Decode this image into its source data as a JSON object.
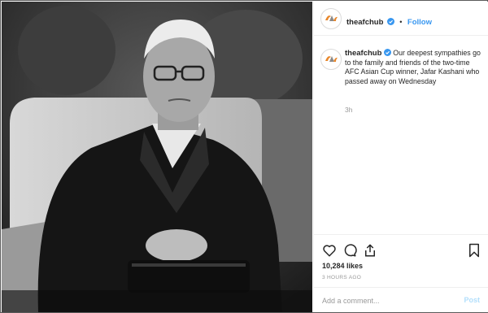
{
  "account": {
    "username": "theafchub",
    "verified_icon": "verified-badge-icon",
    "follow_separator": "•",
    "follow_label": "Follow",
    "avatar_icon": "afc-logo-icon"
  },
  "caption": {
    "username": "theafchub",
    "text": "Our deepest sympathies go to the family and friends of the two-time AFC Asian Cup winner, Jafar Kashani who passed away on Wednesday",
    "time": "3h"
  },
  "engagement": {
    "likes": "10,284 likes",
    "posted": "3 HOURS AGO",
    "icons": [
      "heart-icon",
      "comment-icon",
      "share-icon",
      "bookmark-icon"
    ]
  },
  "comment_box": {
    "placeholder": "Add a comment...",
    "post_label": "Post"
  },
  "colors": {
    "link": "#3897f0",
    "post_disabled": "#b2dffc",
    "logo_orange": "#e8862a",
    "logo_gray": "#8a8a8a"
  }
}
